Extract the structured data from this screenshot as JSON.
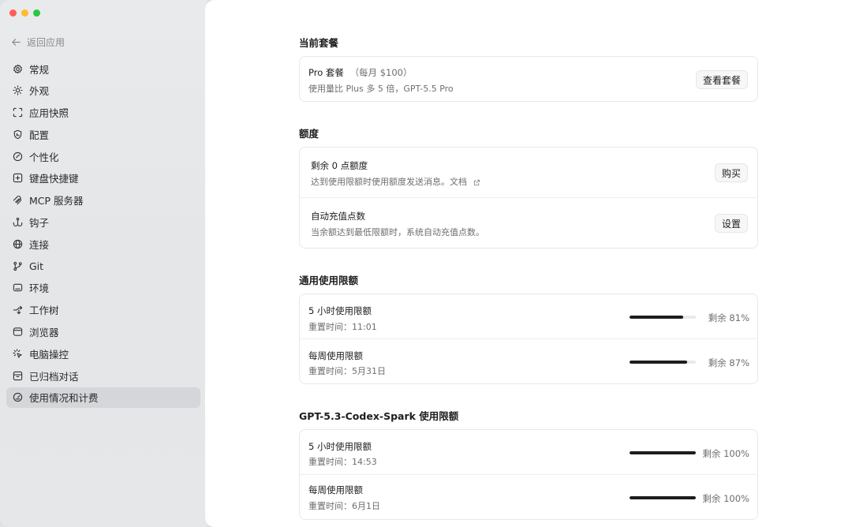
{
  "window": {
    "controls": [
      {
        "name": "close",
        "color": "#ff5f57"
      },
      {
        "name": "minimize",
        "color": "#febc2e"
      },
      {
        "name": "zoom",
        "color": "#28c840"
      }
    ]
  },
  "sidebar": {
    "back_label": "返回应用",
    "items": [
      {
        "label": "常规",
        "icon": "gear-icon"
      },
      {
        "label": "外观",
        "icon": "sun-icon"
      },
      {
        "label": "应用快照",
        "icon": "snapshot-icon"
      },
      {
        "label": "配置",
        "icon": "config-icon"
      },
      {
        "label": "个性化",
        "icon": "personalize-icon"
      },
      {
        "label": "键盘快捷键",
        "icon": "keyboard-icon"
      },
      {
        "label": "MCP 服务器",
        "icon": "mcp-icon"
      },
      {
        "label": "钩子",
        "icon": "hook-icon"
      },
      {
        "label": "连接",
        "icon": "globe-icon"
      },
      {
        "label": "Git",
        "icon": "git-branch-icon"
      },
      {
        "label": "环境",
        "icon": "environment-icon"
      },
      {
        "label": "工作树",
        "icon": "worktree-icon"
      },
      {
        "label": "浏览器",
        "icon": "browser-icon"
      },
      {
        "label": "电脑操控",
        "icon": "computer-control-icon"
      },
      {
        "label": "已归档对话",
        "icon": "archive-icon"
      },
      {
        "label": "使用情况和计费",
        "icon": "gauge-icon",
        "active": true
      }
    ]
  },
  "plan": {
    "section_title": "当前套餐",
    "name": "Pro 套餐",
    "price": "（每月 $100）",
    "description": "使用量比 Plus 多 5 倍，GPT-5.5 Pro",
    "button_label": "查看套餐"
  },
  "credits": {
    "section_title": "额度",
    "balance": {
      "title": "剩余 0 点额度",
      "description": "达到使用限额时使用额度发送消息。文档",
      "button_label": "购买"
    },
    "auto_recharge": {
      "title": "自动充值点数",
      "description": "当余额达到最低限额时，系统自动充值点数。",
      "button_label": "设置"
    }
  },
  "general_limits": {
    "section_title": "通用使用限额",
    "rows": [
      {
        "title": "5 小时使用限额",
        "reset": "重置时间：11:01",
        "remaining_pct": 81,
        "remaining_text": "剩余 81%"
      },
      {
        "title": "每周使用限额",
        "reset": "重置时间：5月31日",
        "remaining_pct": 87,
        "remaining_text": "剩余 87%"
      }
    ]
  },
  "spark_limits": {
    "section_title": "GPT-5.3-Codex-Spark 使用限额",
    "rows": [
      {
        "title": "5 小时使用限额",
        "reset": "重置时间：14:53",
        "remaining_pct": 100,
        "remaining_text": "剩余 100%"
      },
      {
        "title": "每周使用限额",
        "reset": "重置时间：6月1日",
        "remaining_pct": 100,
        "remaining_text": "剩余 100%"
      }
    ]
  }
}
